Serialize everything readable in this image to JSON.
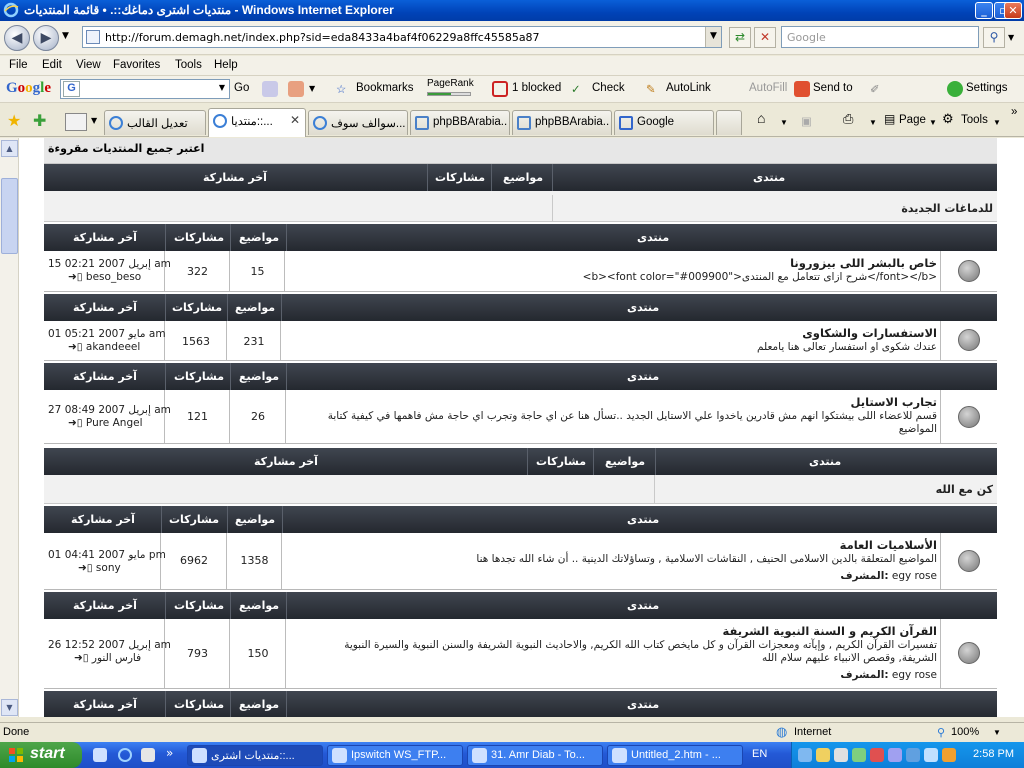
{
  "window": {
    "title": "منتديات اشترى دماغك::. • قائمة المنتديات - Windows Internet Explorer"
  },
  "address": {
    "url": "http://forum.demagh.net/index.php?sid=eda8433a4baf4f06229a8ffc45585a87",
    "search_placeholder": "Google"
  },
  "menu": [
    "File",
    "Edit",
    "View",
    "Favorites",
    "Tools",
    "Help"
  ],
  "google_toolbar": {
    "logo": "Google",
    "go": "Go",
    "bookmarks": "Bookmarks",
    "pagerank": "PageRank",
    "blocked": "1 blocked",
    "check": "Check",
    "autolink": "AutoLink",
    "autofill": "AutoFill",
    "sendto": "Send to",
    "settings": "Settings"
  },
  "tabs": [
    {
      "label": "تعديل القالب"
    },
    {
      "label": "منتديا::...",
      "active": true
    },
    {
      "label": "سوالف سوف..."
    },
    {
      "label": "phpBBArabia..."
    },
    {
      "label": "phpBBArabia..."
    },
    {
      "label": "Google"
    }
  ],
  "command_bar": {
    "page": "Page",
    "tools": "Tools"
  },
  "forum": {
    "mark_all": "اعتبر جميع المنتديات مقروءة",
    "headers": {
      "forum": "منتدى",
      "topics": "مواضيع",
      "posts": "مشاركات",
      "last_post": "آخر مشاركة"
    },
    "cat1": "للدماغات الجديدة",
    "cat2": "كن مع الله",
    "moderator_label": "المشرف:",
    "rows": [
      {
        "name": "خاص بالبشر اللى بيزورونا",
        "desc": "<b><font color=\"#009900\">شرح ازاى تتعامل مع المنتدى</font></b>",
        "topics": "15",
        "posts": "322",
        "date": "15 إبريل 2007 02:21 am",
        "user": "beso_beso"
      },
      {
        "name": "الاستفسارات والشكاوى",
        "desc": "عندك شكوى او استفسار تعالى هنا يامعلم",
        "topics": "231",
        "posts": "1563",
        "date": "01 مايو 2007 05:21 am",
        "user": "akandeeel"
      },
      {
        "name": "تجارب الاستايل",
        "desc": "قسم للاعضاء اللى بيشتكوا انهم مش قادرين ياخدوا علي الاستايل الجديد ..تسأل هنا عن اي حاجة وتجرب اي حاجة مش فاهمها في كيفية كتابة المواضيع",
        "topics": "26",
        "posts": "121",
        "date": "27 إبريل 2007 08:49 am",
        "user": "Pure Angel"
      },
      {
        "name": "الأسلاميات العامة",
        "desc": "المواضيع المتعلقة بالدين الاسلامى الحنيف , النقاشات الاسلامية , وتساؤلاتك الدينية .. أن شاء الله تجدها هنا",
        "moderator": "egy rose",
        "topics": "1358",
        "posts": "6962",
        "date": "01 مايو 2007 04:41 pm",
        "user": "sony"
      },
      {
        "name": "القرآن الكريم و السنة النبوية الشريفة",
        "desc": "تفسيرات القرآن الكريم , وإيآته ومعجزات القرآن و كل مايخص كتاب الله الكريم, والاحاديث النبوية الشريفة والسنن النبوية والسيرة النبوية الشريفة, وقصص الانبياء عليهم سلام الله",
        "moderator": "egy rose",
        "topics": "150",
        "posts": "793",
        "date": "26 إبريل 2007 12:52 am",
        "user": "فارس النور"
      }
    ]
  },
  "statusbar": {
    "left": "Done",
    "zone": "Internet",
    "zoom": "100%"
  },
  "taskbar": {
    "start": "start",
    "tasks": [
      {
        "label": "منتديات اشترى::...",
        "active": true
      },
      {
        "label": "Ipswitch WS_FTP..."
      },
      {
        "label": "31. Amr Diab - To..."
      },
      {
        "label": "Untitled_2.htm - ..."
      }
    ],
    "lang": "EN",
    "clock": "2:58 PM"
  },
  "colors": {
    "header_bg": "#2f343c",
    "titlebar": "#0a5fd8",
    "taskbar": "#2459d6"
  }
}
